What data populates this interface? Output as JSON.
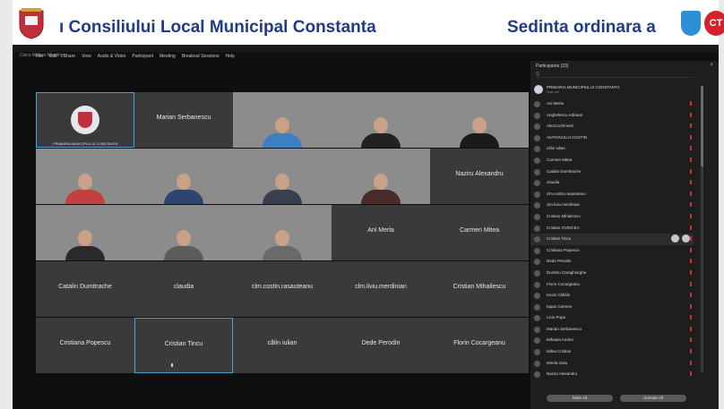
{
  "banner": {
    "left_text": "ı Consiliului Local Municipal Constanta",
    "right_text": "Sedinta ordinara a",
    "ct_logo": "CT"
  },
  "window": {
    "title": "Cisco Webex Meetings",
    "menu": [
      "File",
      "Edit",
      "Share",
      "View",
      "Audio & Video",
      "Participant",
      "Meeting",
      "Breakout Sessions",
      "Help"
    ]
  },
  "tiles": [
    {
      "name": "",
      "label": "PRIMARIA MUNICIPIULUI CONSTANTA",
      "type": "crest",
      "selected": true
    },
    {
      "name": "Marian Serbanescu",
      "type": "name"
    },
    {
      "name": "",
      "type": "video",
      "color": "#3f7fc0"
    },
    {
      "name": "",
      "type": "video",
      "color": "#222222"
    },
    {
      "name": "",
      "type": "video",
      "color": "#1b1b1b"
    },
    {
      "name": "",
      "type": "video",
      "color": "#c24040"
    },
    {
      "name": "",
      "type": "video",
      "color": "#2e4470"
    },
    {
      "name": "",
      "type": "video",
      "color": "#3a3f4f"
    },
    {
      "name": "",
      "type": "video",
      "color": "#4a2a2a"
    },
    {
      "name": "Naziru Alexandru",
      "type": "name"
    },
    {
      "name": "",
      "type": "video",
      "color": "#2a2a2a"
    },
    {
      "name": "",
      "type": "video",
      "color": "#5c5c5c"
    },
    {
      "name": "",
      "type": "video",
      "color": "#6a6a6a"
    },
    {
      "name": "Ani Merla",
      "type": "name"
    },
    {
      "name": "Carmen Mitea",
      "type": "name"
    },
    {
      "name": "Catalin Dumitrache",
      "type": "name"
    },
    {
      "name": "claudia",
      "type": "name"
    },
    {
      "name": "clm.costin.rasauteanu",
      "type": "name"
    },
    {
      "name": "clm.liviu.merdinian",
      "type": "name"
    },
    {
      "name": "Cristian Mihailescu",
      "type": "name"
    },
    {
      "name": "Cristiana Popescu",
      "type": "name"
    },
    {
      "name": "Cristian Tincu",
      "type": "name",
      "selected": true
    },
    {
      "name": "călin iulian",
      "type": "name"
    },
    {
      "name": "Dede Perodin",
      "type": "name"
    },
    {
      "name": "Florin Cocargeanu",
      "type": "name"
    }
  ],
  "panel": {
    "title": "Participants (33)",
    "close": "×",
    "search_placeholder": "Q",
    "host": {
      "name": "PRIMARIA MUNICIPIULUI CONSTANTA",
      "sub": "Host, me"
    },
    "participants": [
      "Ani Merla",
      "Anghelescu Adriana",
      "AlexCochinesti",
      "AVATANULUI COSTIN",
      "călin iulian",
      "Carmen Mitea",
      "Catalin Dumitrache",
      "claudia",
      "clm.costin.rasauteanu",
      "clm.liviu.merdinian",
      "Cristian Mihailescu",
      "Cristian OVIDCEA",
      "Cristian Tincu",
      "Cristiana Popescu",
      "Dede Perodin",
      "Dumitru Caraghiorghe",
      "Florin Cocargeanu",
      "Iacob Cătălin",
      "Iapas Carmen",
      "Liviu Popa",
      "Marian Serbanescu",
      "Mihaela Andrei",
      "Mihai Cristian",
      "Mirela Gatu",
      "Naziru Alexandru"
    ],
    "highlighted": "Cristian Tincu",
    "buttons": {
      "mute_all": "Mute All",
      "unmute_all": "Unmute All"
    }
  },
  "colors": {
    "accent": "#4aa3d6",
    "banner_text": "#1f3b8a",
    "ct_red": "#d6202b"
  }
}
